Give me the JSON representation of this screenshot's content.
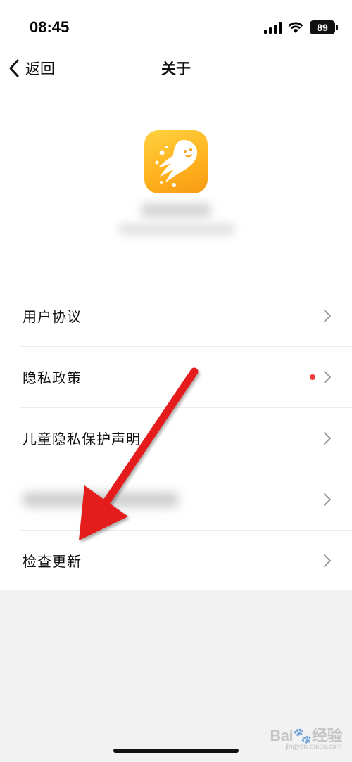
{
  "status_bar": {
    "time": "08:45",
    "battery": "89"
  },
  "nav": {
    "back_label": "返回",
    "title": "关于"
  },
  "list": {
    "items": [
      {
        "label": "用户协议"
      },
      {
        "label": "隐私政策",
        "badge": "red-dot"
      },
      {
        "label": "儿童隐私保护声明"
      },
      {
        "label": ""
      },
      {
        "label": "检查更新"
      }
    ]
  },
  "watermark": {
    "text": "Bai🐾经验",
    "url": "jingyan.baidu.com"
  },
  "colors": {
    "badge": "#f03b3b",
    "arrow": "#e41c1c",
    "icon_gradient_top": "#ffd23f",
    "icon_gradient_bottom": "#f79a12"
  }
}
